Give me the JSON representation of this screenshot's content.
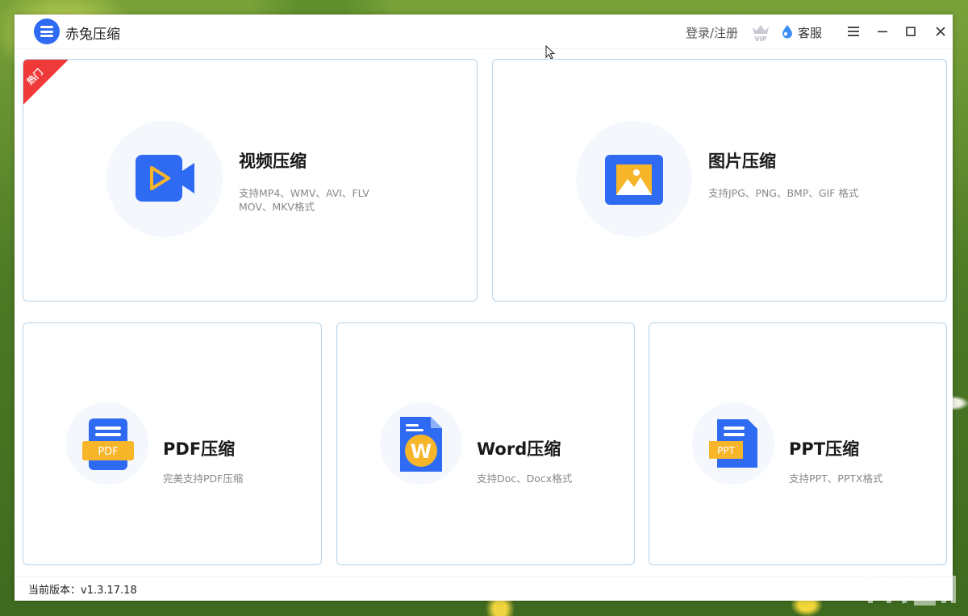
{
  "app": {
    "title": "赤兔压缩",
    "login_label": "登录/注册",
    "vip_label": "VIP",
    "service_label": "客服",
    "brand_color": "#2f6bf2",
    "icons": [
      "app-logo-icon",
      "vip-crown-icon",
      "service-drop-icon",
      "menu-icon",
      "minimize-icon",
      "maximize-icon",
      "close-icon"
    ]
  },
  "cards": {
    "video": {
      "badge": "热门",
      "title": "视频压缩",
      "desc": "支持MP4、WMV、AVI、FLV MOV、MKV格式",
      "icon": "video-camera-icon"
    },
    "image": {
      "title": "图片压缩",
      "desc": "支持JPG、PNG、BMP、GIF 格式",
      "icon": "image-icon"
    },
    "pdf": {
      "title": "PDF压缩",
      "desc": "完美支持PDF压缩",
      "icon_text": "PDF",
      "icon": "pdf-document-icon"
    },
    "word": {
      "title": "Word压缩",
      "desc": "支持Doc、Docx格式",
      "icon_text": "W",
      "icon": "word-document-icon"
    },
    "ppt": {
      "title": "PPT压缩",
      "desc": "支持PPT、PPTX格式",
      "icon_text": "PPT",
      "icon": "ppt-document-icon"
    }
  },
  "status": {
    "version_label": "当前版本：v1.3.17.18"
  },
  "colors": {
    "card_border": "#b7d3e8",
    "icon_blue": "#2f6bf2",
    "icon_yellow": "#f7b52a",
    "hot_badge": "#f03a3a"
  }
}
